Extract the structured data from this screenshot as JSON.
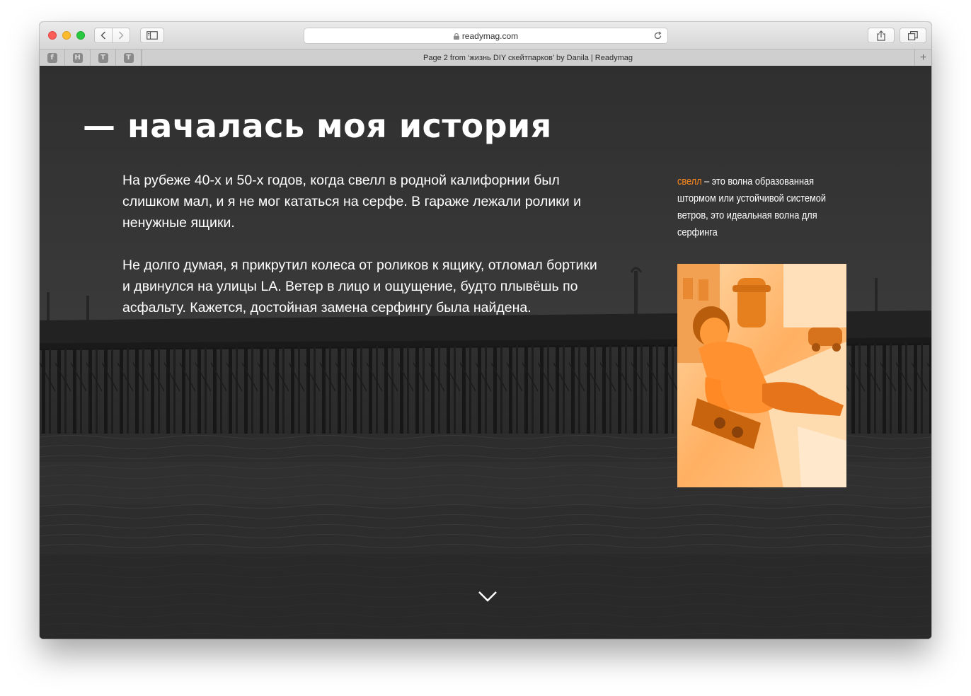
{
  "browser": {
    "address": "readymag.com",
    "tab_title": "Page 2 from ‘жизнь DIY скейтпарков’ by Danila | Readymag",
    "favorites": [
      {
        "icon": "facebook-icon",
        "glyph": "f"
      },
      {
        "icon": "habr-icon",
        "glyph": "H"
      },
      {
        "icon": "t-icon",
        "glyph": "T"
      },
      {
        "icon": "t-icon",
        "glyph": "T"
      }
    ],
    "new_tab_label": "+"
  },
  "page": {
    "headline": "— началась моя история",
    "paragraph_1": "На рубеже 40-х и 50-х годов, когда свелл в родной калифорнии был слишком мал, и я не мог кататься на серфе. В гараже лежали ролики и ненужные ящики.",
    "paragraph_2": "Не долго думая, я прикрутил колеса от роликов к ящику, отломал бортики и двинулся на улицы LA. Ветер в лицо и ощущение, будто плывёшь по асфальту. Кажется, достойная замена серфингу была найдена.",
    "sidenote": {
      "term": "свелл",
      "definition": " – это волна образованная штормом или устойчивой системой ветров, это идеальная волна для серфинга"
    },
    "scroll_icon": "chevron-down-icon"
  },
  "colors": {
    "accent": "#ff8a1e",
    "background": "#313131",
    "text": "#ffffff"
  }
}
